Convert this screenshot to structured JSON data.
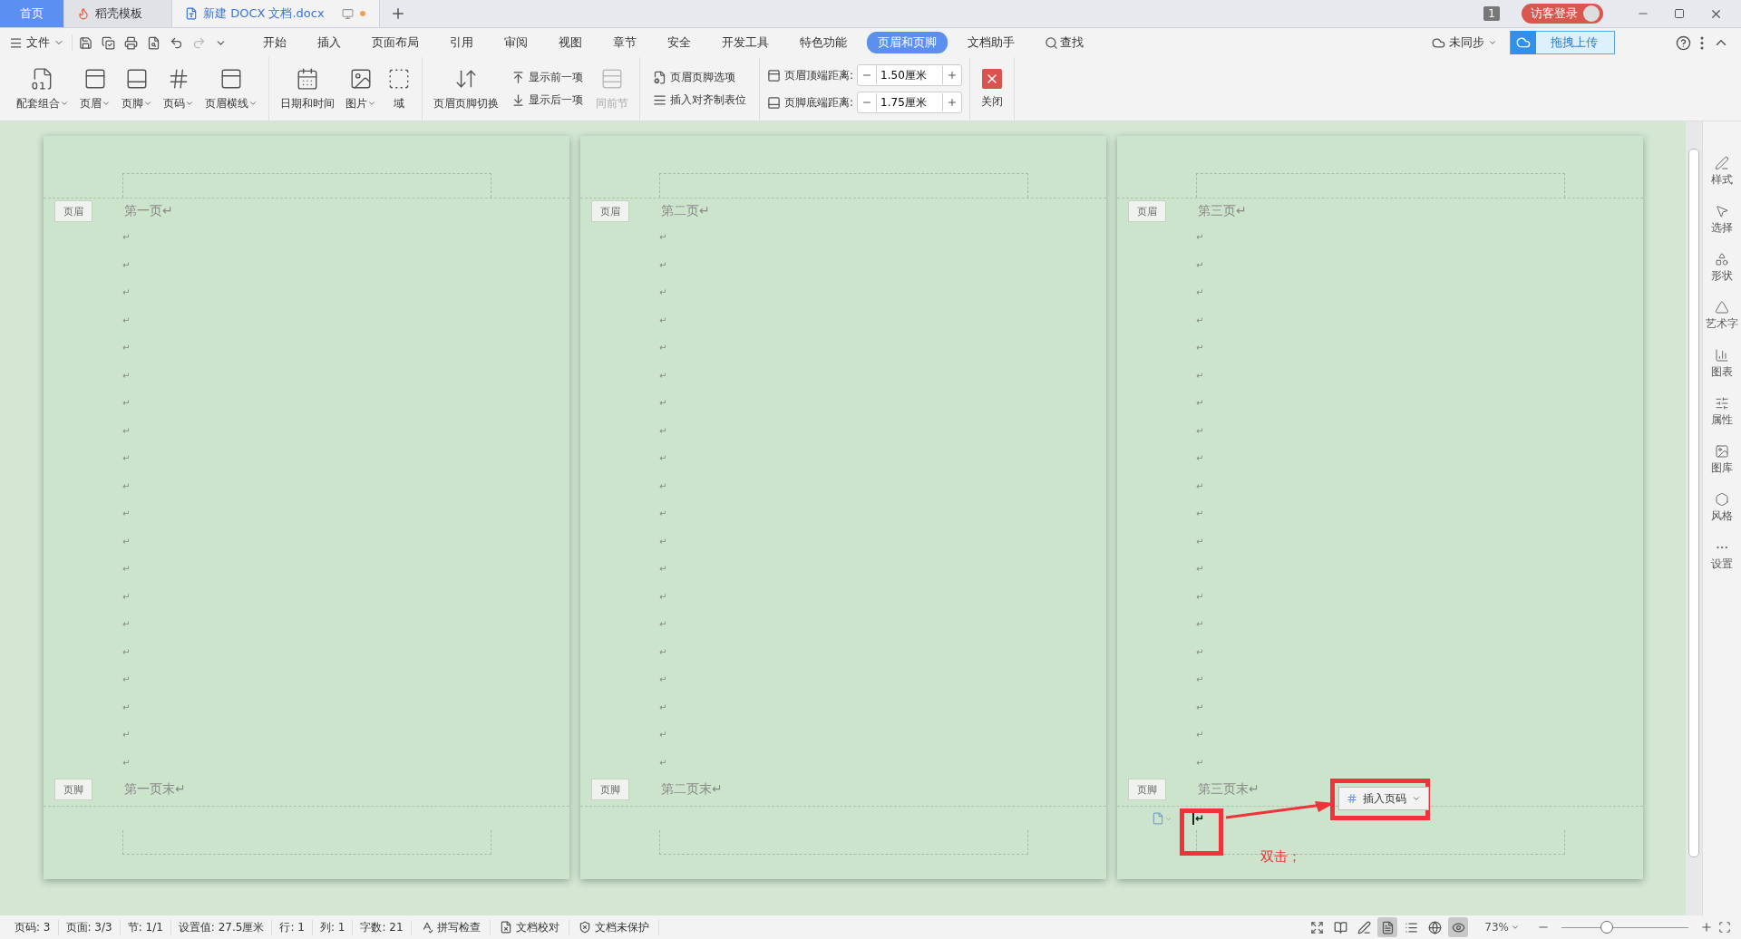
{
  "doc_tabs": [
    {
      "kind": "home",
      "label": "首页",
      "selected": false
    },
    {
      "kind": "template",
      "label": "稻壳模板",
      "selected": false
    },
    {
      "kind": "document",
      "label": "新建 DOCX 文档.docx",
      "selected": true
    }
  ],
  "window_badge": "1",
  "login": "访客登录",
  "menu": {
    "file": "文件",
    "tabs": [
      {
        "label": "开始",
        "selected": false
      },
      {
        "label": "插入",
        "selected": false
      },
      {
        "label": "页面布局",
        "selected": false
      },
      {
        "label": "引用",
        "selected": false
      },
      {
        "label": "审阅",
        "selected": false
      },
      {
        "label": "视图",
        "selected": false
      },
      {
        "label": "章节",
        "selected": false
      },
      {
        "label": "安全",
        "selected": false
      },
      {
        "label": "开发工具",
        "selected": false
      },
      {
        "label": "特色功能",
        "selected": false
      },
      {
        "label": "页眉和页脚",
        "selected": true
      },
      {
        "label": "文档助手",
        "selected": false
      }
    ],
    "search": "查找",
    "sync": "未同步",
    "upload": "拖拽上传"
  },
  "ribbon": [
    {
      "kind": "big",
      "items": [
        {
          "label": "配套组合",
          "dropdown": true,
          "disabled": false
        },
        {
          "label": "页眉",
          "dropdown": true,
          "disabled": false
        },
        {
          "label": "页脚",
          "dropdown": true,
          "disabled": false
        },
        {
          "label": "页码",
          "dropdown": true,
          "disabled": false
        },
        {
          "label": "页眉横线",
          "dropdown": true,
          "disabled": false
        }
      ]
    },
    {
      "kind": "big",
      "items": [
        {
          "label": "日期和时间",
          "dropdown": false,
          "disabled": false
        },
        {
          "label": "图片",
          "dropdown": true,
          "disabled": false
        },
        {
          "label": "域",
          "dropdown": false,
          "disabled": false
        }
      ]
    },
    {
      "kind": "mixed",
      "items": [
        {
          "label": "页眉页脚切换",
          "dropdown": false,
          "disabled": false
        }
      ],
      "small": [
        {
          "label": "显示前一项",
          "disabled": false
        },
        {
          "label": "显示后一项",
          "disabled": false
        }
      ],
      "after": [
        {
          "label": "同前节",
          "dropdown": false,
          "disabled": true
        }
      ]
    },
    {
      "kind": "small",
      "small": [
        {
          "label": "页眉页脚选项",
          "disabled": false
        },
        {
          "label": "插入对齐制表位",
          "disabled": false
        }
      ]
    },
    {
      "kind": "spinners",
      "spinners": [
        {
          "label": "页眉顶端距离:",
          "value": "1.50厘米"
        },
        {
          "label": "页脚底端距离:",
          "value": "1.75厘米"
        }
      ]
    },
    {
      "kind": "close",
      "items": [
        {
          "label": "关闭",
          "dropdown": false,
          "disabled": false
        }
      ]
    }
  ],
  "pages": [
    {
      "header_label": "页眉",
      "header_text": "第一页↵",
      "marks": [
        "↵",
        "↵",
        "↵",
        "↵",
        "↵",
        "↵",
        "↵",
        "↵",
        "↵",
        "↵",
        "↵",
        "↵",
        "↵",
        "↵",
        "↵",
        "↵",
        "↵",
        "↵",
        "↵",
        "↵"
      ],
      "footer_label": "页脚",
      "footer_text": "第一页末↵",
      "editing": false
    },
    {
      "header_label": "页眉",
      "header_text": "第二页↵",
      "marks": [
        "↵",
        "↵",
        "↵",
        "↵",
        "↵",
        "↵",
        "↵",
        "↵",
        "↵",
        "↵",
        "↵",
        "↵",
        "↵",
        "↵",
        "↵",
        "↵",
        "↵",
        "↵",
        "↵",
        "↵"
      ],
      "footer_label": "页脚",
      "footer_text": "第二页末↵",
      "editing": false
    },
    {
      "header_label": "页眉",
      "header_text": "第三页↵",
      "marks": [
        "↵",
        "↵",
        "↵",
        "↵",
        "↵",
        "↵",
        "↵",
        "↵",
        "↵",
        "↵",
        "↵",
        "↵",
        "↵",
        "↵",
        "↵",
        "↵",
        "↵",
        "↵",
        "↵",
        "↵"
      ],
      "footer_label": "页脚",
      "footer_text": "第三页末↵",
      "editing": true,
      "footer_line": "↵",
      "insert_button": "插入页码",
      "hint": "双击；"
    }
  ],
  "sidebar": [
    "样式",
    "选择",
    "形状",
    "艺术字",
    "图表",
    "属性",
    "图库",
    "风格",
    "设置"
  ],
  "status_bar": {
    "fields": [
      "页码: 3",
      "页面: 3/3",
      "节: 1/1",
      "设置值: 27.5厘米",
      "行: 1",
      "列: 1",
      "字数: 21"
    ],
    "tools": [
      "拼写检查",
      "文档校对",
      "文档未保护"
    ],
    "views": [
      {
        "kind": "fullscreen",
        "selected": false
      },
      {
        "kind": "read",
        "selected": false
      },
      {
        "kind": "write",
        "selected": false
      },
      {
        "kind": "page",
        "selected": true
      },
      {
        "kind": "outline",
        "selected": false
      },
      {
        "kind": "web",
        "selected": false
      },
      {
        "kind": "eye",
        "selected": true
      }
    ],
    "zoom": "73%",
    "zoom_slider": {
      "level": 0.36
    }
  }
}
